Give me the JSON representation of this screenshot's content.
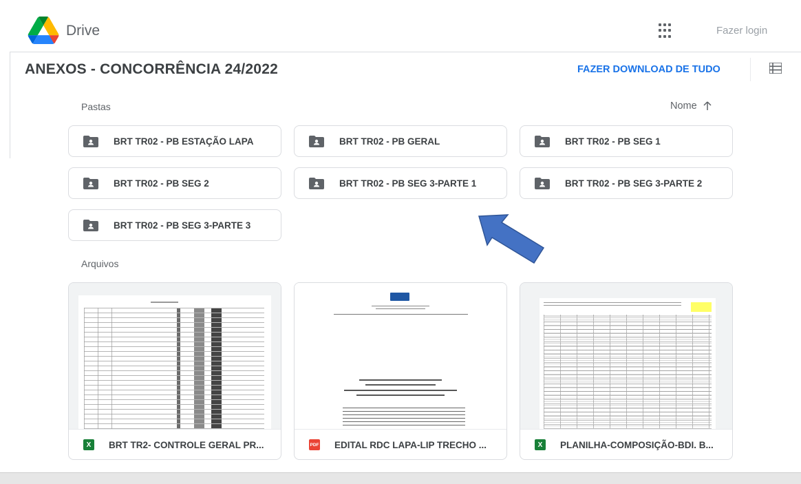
{
  "header": {
    "app_name": "Drive",
    "login_label": "Fazer login"
  },
  "title_row": {
    "title": "ANEXOS - CONCORRÊNCIA 24/2022",
    "download_label": "FAZER DOWNLOAD DE TUDO"
  },
  "folders_section": {
    "label": "Pastas",
    "sort_label": "Nome",
    "items": [
      "BRT TR02 - PB ESTAÇÃO LAPA",
      "BRT TR02 - PB GERAL",
      "BRT TR02 - PB SEG 1",
      "BRT TR02 - PB SEG 2",
      "BRT TR02 - PB SEG 3-PARTE 1",
      "BRT TR02 - PB SEG 3-PARTE 2",
      "BRT TR02 - PB SEG 3-PARTE 3"
    ]
  },
  "files_section": {
    "label": "Arquivos",
    "items": [
      {
        "name": "BRT TR2- CONTROLE GERAL PR...",
        "type_badge": "X",
        "type_color": "#188038"
      },
      {
        "name": "EDITAL RDC LAPA-LIP TRECHO ...",
        "type_badge": "PDF",
        "type_color": "#ea4335"
      },
      {
        "name": "PLANILHA-COMPOSIÇÃO-BDI. B...",
        "type_badge": "X",
        "type_color": "#188038"
      }
    ]
  },
  "colors": {
    "accent": "#1a73e8",
    "annotation_arrow": "#4472c4"
  }
}
